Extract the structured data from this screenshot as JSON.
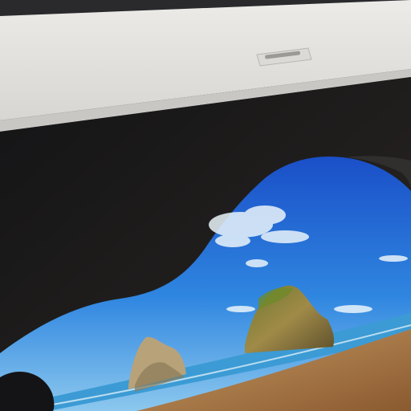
{
  "scene": {
    "description_type": "photograph",
    "subject": "laptop-lid-with-lock-screen",
    "colors": {
      "lid": "#e3e1de",
      "lid_shadow": "#cfcdca",
      "bezel": "#0d0f14",
      "cave_dark": "#1a1a1c",
      "sky_top": "#1f5fd8",
      "sky_bottom": "#6fb6ec",
      "sea": "#3a98d0",
      "sand": "#b98a55",
      "rock": "#8a7a3a",
      "rock_dark": "#4f4a2a"
    },
    "icons": {
      "camera": "webcam-icon"
    }
  }
}
